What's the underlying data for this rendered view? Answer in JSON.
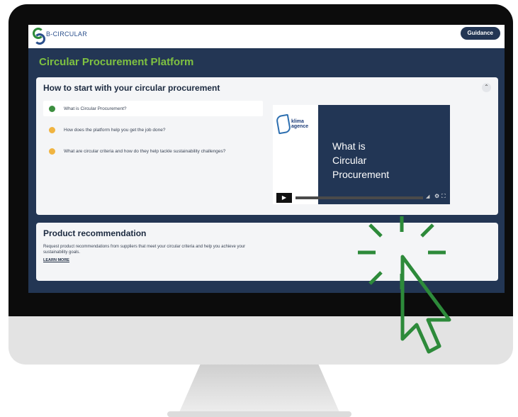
{
  "header": {
    "logo_text": "B-CIRCULAR",
    "guidance_label": "Guidance"
  },
  "page_title": "Circular Procurement Platform",
  "start_card": {
    "title": "How to start with your circular procurement",
    "steps": [
      {
        "label": "What is Circular Procurement?",
        "status": "active"
      },
      {
        "label": "How does the platform help you get the job done?",
        "status": "pending"
      },
      {
        "label": "What are circular criteria and how do they help tackle sustainability challenges?",
        "status": "pending"
      }
    ],
    "video": {
      "brand_line1": "klima",
      "brand_line2": "agence",
      "title_lines": [
        "What is",
        "Circular",
        "Procurement"
      ],
      "play_icon": "play-icon"
    }
  },
  "recommendation_card": {
    "title": "Product recommendation",
    "description": "Request product recommendations from suppliers that meet your circular criteria and help you achieve your sustainability goals.",
    "learn_more": "LEARN MORE"
  },
  "colors": {
    "app_background": "#233654",
    "title_green": "#7fc241",
    "accent_green": "#2d8a3a",
    "step_orange": "#f0b441"
  }
}
